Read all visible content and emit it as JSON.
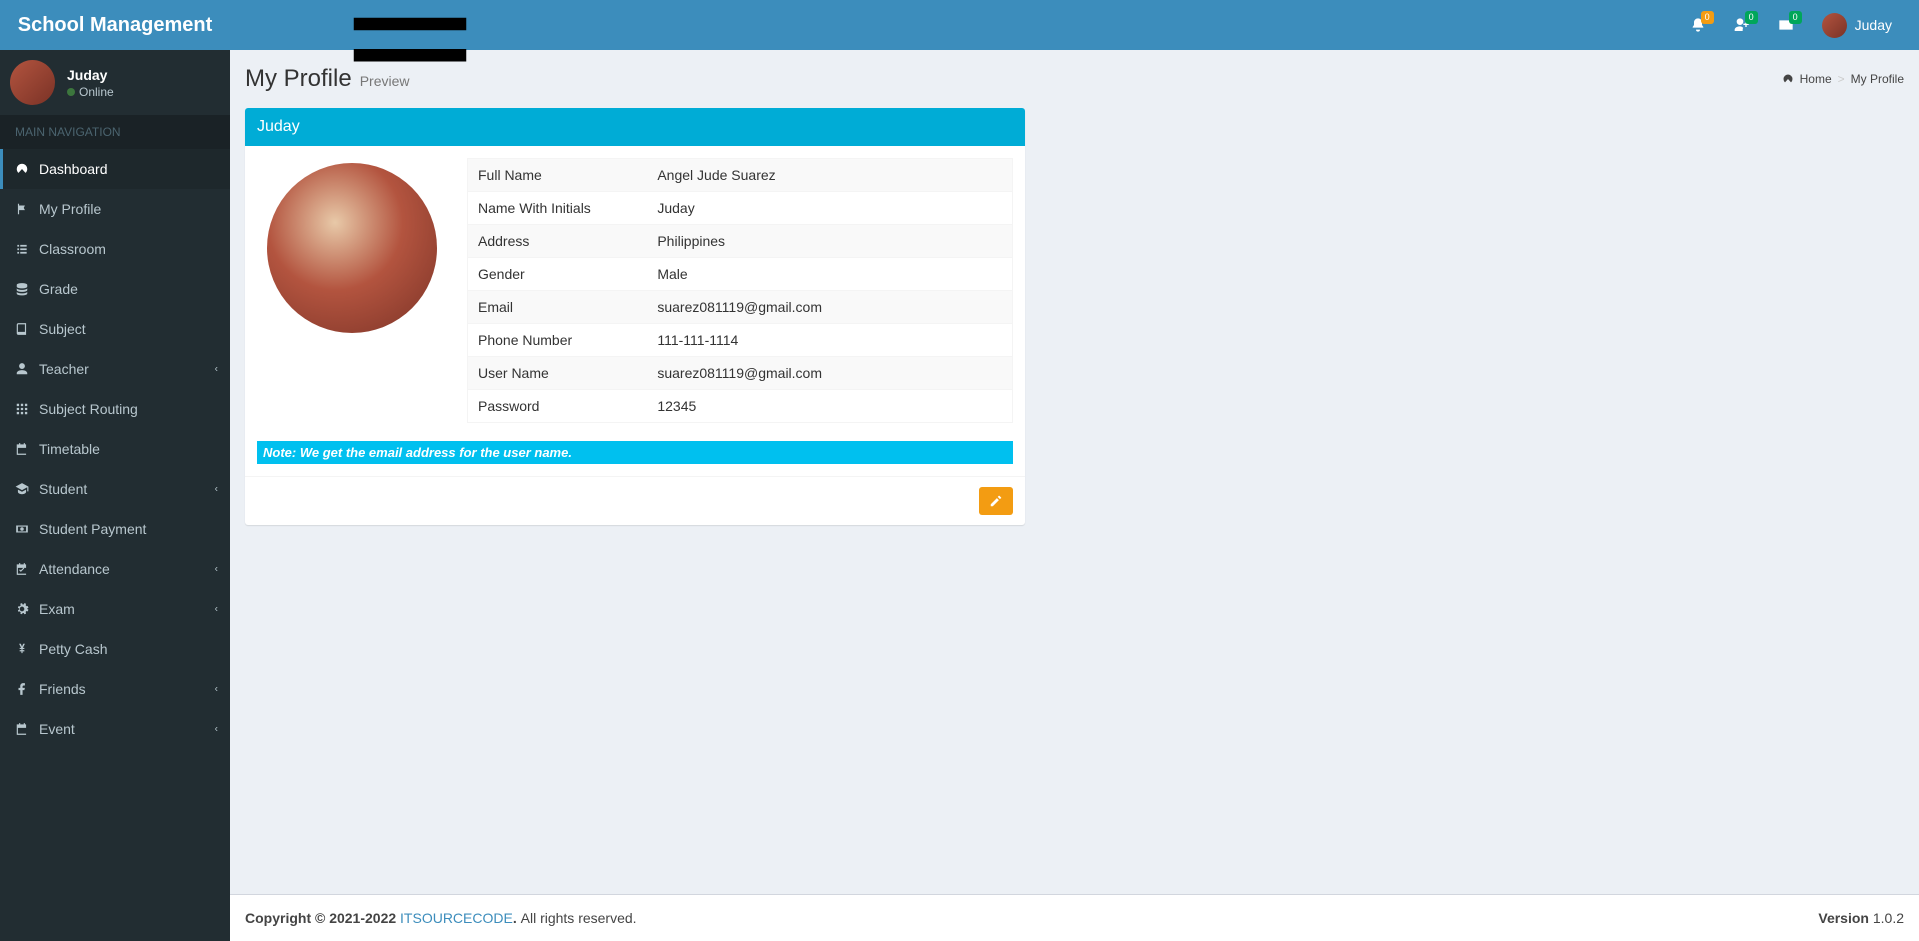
{
  "header": {
    "brand": "School Management",
    "user_name": "Juday",
    "badges": {
      "bell": "0",
      "user_plus": "0",
      "mail": "0"
    }
  },
  "sidebar": {
    "user": {
      "name": "Juday",
      "status": "Online"
    },
    "section_label": "MAIN NAVIGATION",
    "items": [
      {
        "label": "Dashboard",
        "icon": "dashboard",
        "active": true
      },
      {
        "label": "My Profile",
        "icon": "flag"
      },
      {
        "label": "Classroom",
        "icon": "list"
      },
      {
        "label": "Grade",
        "icon": "database"
      },
      {
        "label": "Subject",
        "icon": "book"
      },
      {
        "label": "Teacher",
        "icon": "user",
        "chev": true
      },
      {
        "label": "Subject Routing",
        "icon": "grid"
      },
      {
        "label": "Timetable",
        "icon": "calendar"
      },
      {
        "label": "Student",
        "icon": "grad",
        "chev": true
      },
      {
        "label": "Student Payment",
        "icon": "money"
      },
      {
        "label": "Attendance",
        "icon": "calcheck",
        "chev": true
      },
      {
        "label": "Exam",
        "icon": "gear",
        "chev": true
      },
      {
        "label": "Petty Cash",
        "icon": "yen"
      },
      {
        "label": "Friends",
        "icon": "fb",
        "chev": true
      },
      {
        "label": "Event",
        "icon": "calendar",
        "chev": true
      }
    ]
  },
  "page": {
    "title": "My Profile",
    "subtitle": "Preview",
    "breadcrumb": {
      "home": "Home",
      "current": "My Profile"
    }
  },
  "profile": {
    "header": "Juday",
    "rows": [
      {
        "label": "Full Name",
        "value": "Angel Jude Suarez"
      },
      {
        "label": "Name With Initials",
        "value": "Juday"
      },
      {
        "label": "Address",
        "value": "Philippines"
      },
      {
        "label": "Gender",
        "value": "Male"
      },
      {
        "label": "Email",
        "value": "suarez081119@gmail.com"
      },
      {
        "label": "Phone Number",
        "value": "111-111-1114"
      },
      {
        "label": "User Name",
        "value": "suarez081119@gmail.com"
      },
      {
        "label": "Password",
        "value": "12345"
      }
    ],
    "note": "Note: We get the email address for the user name."
  },
  "footer": {
    "copyright_prefix": "Copyright © 2021-2022 ",
    "link": "ITSOURCECODE",
    "copyright_suffix": ". ",
    "rights": "All rights reserved.",
    "version_label": "Version",
    "version": " 1.0.2"
  }
}
